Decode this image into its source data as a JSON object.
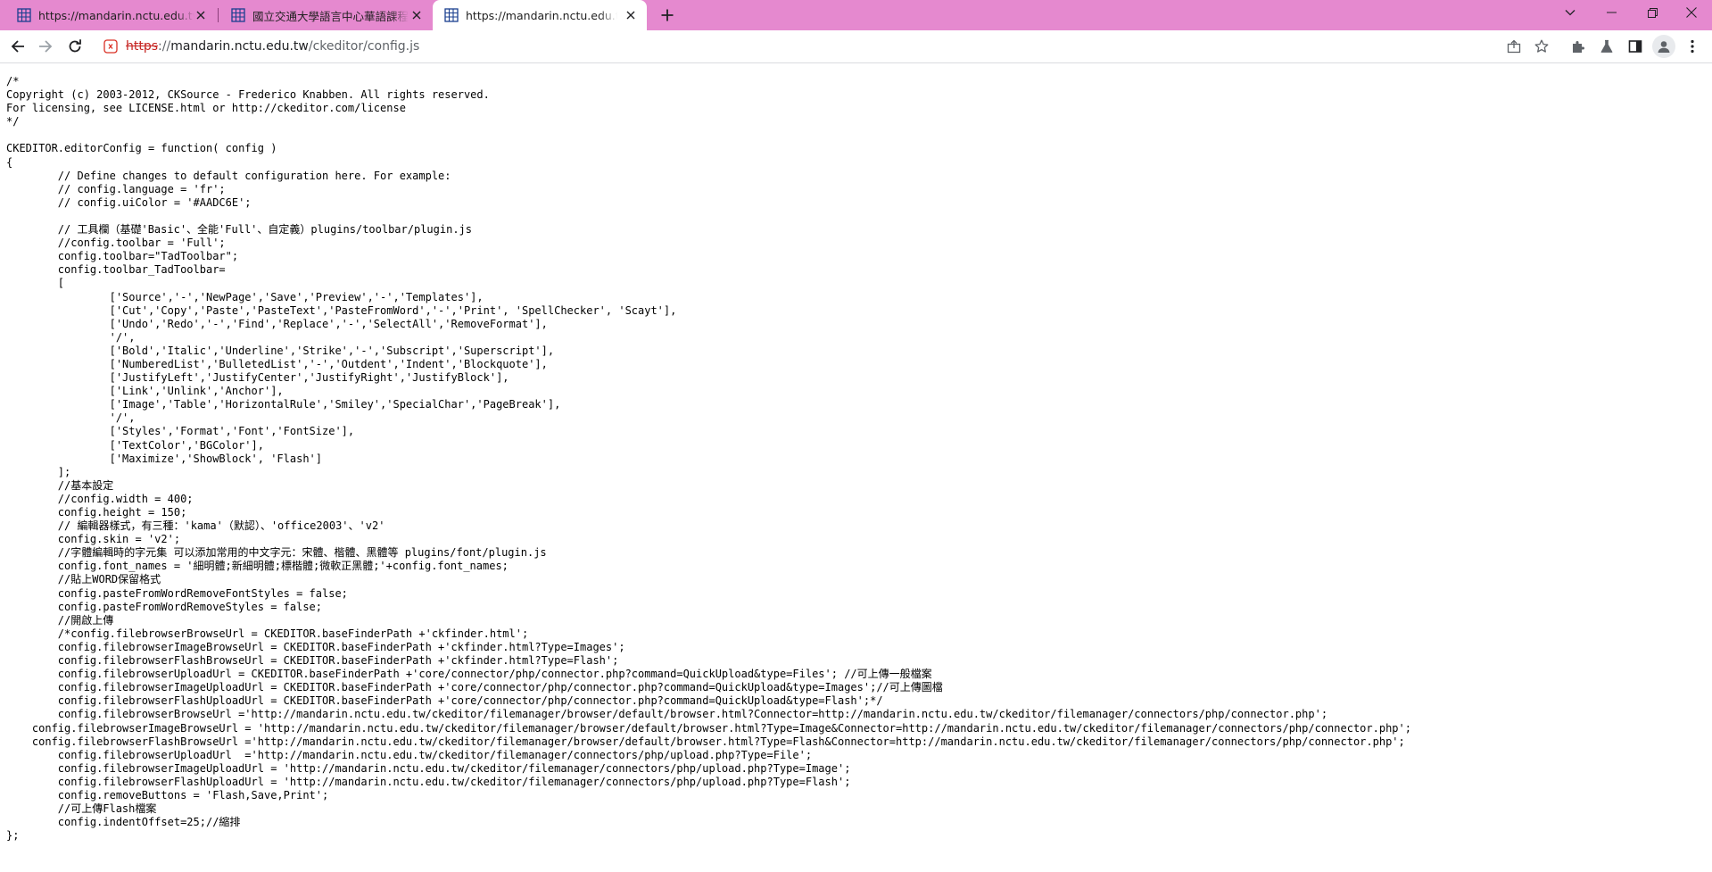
{
  "tabs": [
    {
      "title": "https://mandarin.nctu.edu.tw/ckeditor/",
      "icon": "page-grid-icon",
      "active": false
    },
    {
      "title": "國立交通大學語言中心華語課程",
      "icon": "page-grid-icon",
      "active": false
    },
    {
      "title": "https://mandarin.nctu.edu.tw/ckeditor/config.js",
      "icon": "page-grid-icon",
      "active": true
    }
  ],
  "colors": {
    "tabbar": "#e589cf",
    "scheme_strike": "#c5221f",
    "text": "#000000"
  },
  "addressbar": {
    "scheme": "https",
    "separator": "://",
    "host": "mandarin.nctu.edu.tw",
    "path": "/ckeditor/config.js"
  },
  "file_lines": [
    "/*",
    "Copyright (c) 2003-2012, CKSource - Frederico Knabben. All rights reserved.",
    "For licensing, see LICENSE.html or http://ckeditor.com/license",
    "*/",
    "",
    "CKEDITOR.editorConfig = function( config )",
    "{",
    "\t// Define changes to default configuration here. For example:",
    "\t// config.language = 'fr';",
    "\t// config.uiColor = '#AADC6E';",
    "",
    "\t// 工具欄（基礎'Basic'、全能'Full'、自定義）plugins/toolbar/plugin.js",
    "\t//config.toolbar = 'Full';",
    "\tconfig.toolbar=\"TadToolbar\";",
    "\tconfig.toolbar_TadToolbar=",
    "\t[",
    "\t\t['Source','-','NewPage','Save','Preview','-','Templates'],",
    "\t\t['Cut','Copy','Paste','PasteText','PasteFromWord','-','Print', 'SpellChecker', 'Scayt'],",
    "\t\t['Undo','Redo','-','Find','Replace','-','SelectAll','RemoveFormat'],",
    "\t\t'/',",
    "\t\t['Bold','Italic','Underline','Strike','-','Subscript','Superscript'],",
    "\t\t['NumberedList','BulletedList','-','Outdent','Indent','Blockquote'],",
    "\t\t['JustifyLeft','JustifyCenter','JustifyRight','JustifyBlock'],",
    "\t\t['Link','Unlink','Anchor'],",
    "\t\t['Image','Table','HorizontalRule','Smiley','SpecialChar','PageBreak'],",
    "\t\t'/',",
    "\t\t['Styles','Format','Font','FontSize'],",
    "\t\t['TextColor','BGColor'],",
    "\t\t['Maximize','ShowBlock', 'Flash']",
    "\t];",
    "\t//基本設定",
    "\t//config.width = 400;",
    "\tconfig.height = 150;",
    "\t// 編輯器樣式，有三種：'kama'（默認）、'office2003'、'v2'",
    "\tconfig.skin = 'v2';",
    "\t//字體編輯時的字元集 可以添加常用的中文字元：宋體、楷體、黑體等 plugins/font/plugin.js",
    "\tconfig.font_names = '細明體;新細明體;標楷體;微軟正黑體;'+config.font_names;",
    "\t//貼上WORD保留格式",
    "\tconfig.pasteFromWordRemoveFontStyles = false;",
    "\tconfig.pasteFromWordRemoveStyles = false;",
    "\t//開啟上傳",
    "\t/*config.filebrowserBrowseUrl = CKEDITOR.baseFinderPath +'ckfinder.html';",
    "\tconfig.filebrowserImageBrowseUrl = CKEDITOR.baseFinderPath +'ckfinder.html?Type=Images';",
    "\tconfig.filebrowserFlashBrowseUrl = CKEDITOR.baseFinderPath +'ckfinder.html?Type=Flash';",
    "\tconfig.filebrowserUploadUrl = CKEDITOR.baseFinderPath +'core/connector/php/connector.php?command=QuickUpload&type=Files'; //可上傳一般檔案",
    "\tconfig.filebrowserImageUploadUrl = CKEDITOR.baseFinderPath +'core/connector/php/connector.php?command=QuickUpload&type=Images';//可上傳圖檔",
    "\tconfig.filebrowserFlashUploadUrl = CKEDITOR.baseFinderPath +'core/connector/php/connector.php?command=QuickUpload&type=Flash';*/",
    "\tconfig.filebrowserBrowseUrl ='http://mandarin.nctu.edu.tw/ckeditor/filemanager/browser/default/browser.html?Connector=http://mandarin.nctu.edu.tw/ckeditor/filemanager/connectors/php/connector.php';",
    "    config.filebrowserImageBrowseUrl = 'http://mandarin.nctu.edu.tw/ckeditor/filemanager/browser/default/browser.html?Type=Image&Connector=http://mandarin.nctu.edu.tw/ckeditor/filemanager/connectors/php/connector.php';",
    "    config.filebrowserFlashBrowseUrl ='http://mandarin.nctu.edu.tw/ckeditor/filemanager/browser/default/browser.html?Type=Flash&Connector=http://mandarin.nctu.edu.tw/ckeditor/filemanager/connectors/php/connector.php';",
    "\tconfig.filebrowserUploadUrl  ='http://mandarin.nctu.edu.tw/ckeditor/filemanager/connectors/php/upload.php?Type=File';",
    "\tconfig.filebrowserImageUploadUrl = 'http://mandarin.nctu.edu.tw/ckeditor/filemanager/connectors/php/upload.php?Type=Image';",
    "\tconfig.filebrowserFlashUploadUrl = 'http://mandarin.nctu.edu.tw/ckeditor/filemanager/connectors/php/upload.php?Type=Flash';",
    "\tconfig.removeButtons = 'Flash,Save,Print';",
    "\t//可上傳Flash檔案",
    "\tconfig.indentOffset=25;//縮排",
    "};"
  ]
}
